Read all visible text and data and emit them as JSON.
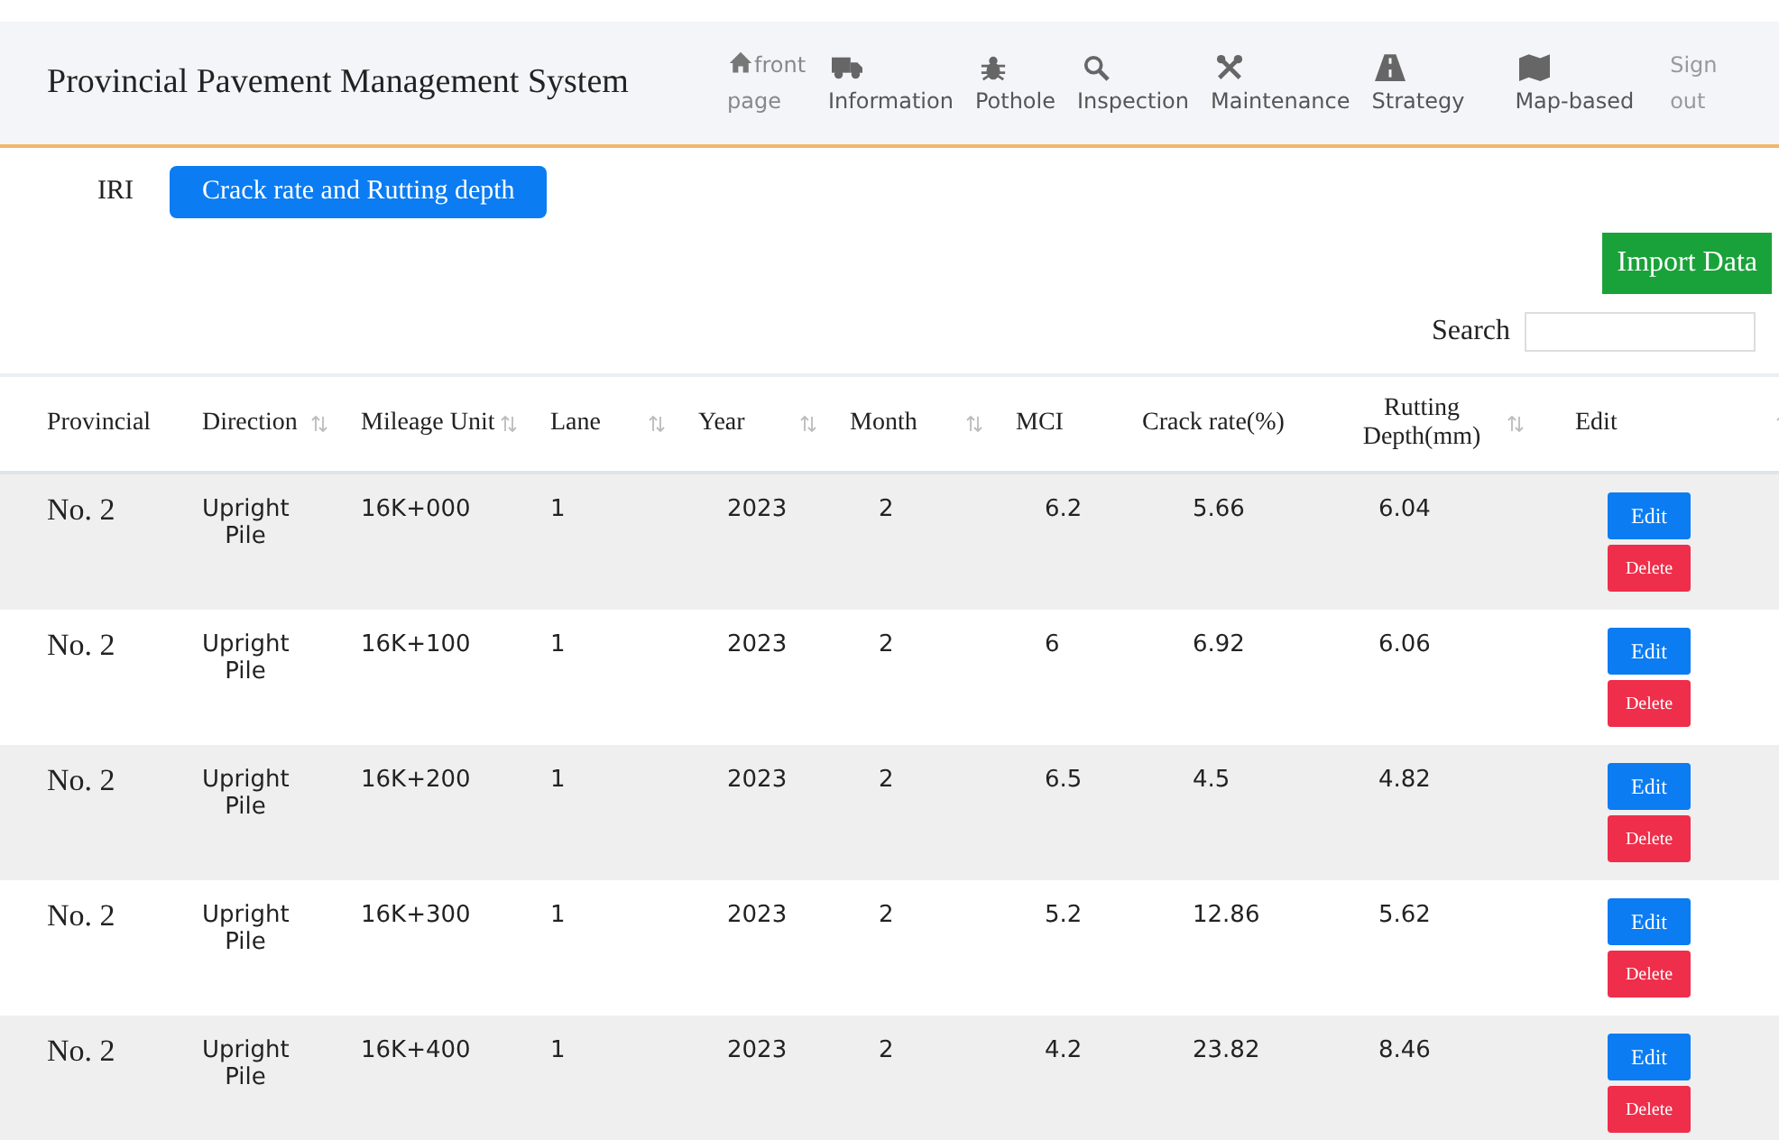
{
  "header": {
    "title": "Provincial Pavement Management System"
  },
  "nav": [
    {
      "label": "front page",
      "kind": "inline"
    },
    {
      "label": "Information",
      "kind": "stacked"
    },
    {
      "label": "Pothole",
      "kind": "stacked"
    },
    {
      "label": "Inspection",
      "kind": "stacked"
    },
    {
      "label": "Maintenance",
      "kind": "stacked"
    },
    {
      "label": "Strategy",
      "kind": "stacked"
    },
    {
      "label": "Map-based",
      "kind": "stacked"
    },
    {
      "label": "Sign out",
      "kind": "plain"
    }
  ],
  "tabs": [
    {
      "label": "IRI",
      "selected": false
    },
    {
      "label": "Crack rate and Rutting depth",
      "selected": true
    }
  ],
  "import_button": "Import Data",
  "search": {
    "label": "Search"
  },
  "table": {
    "columns": [
      {
        "label": "Provincial",
        "sortable": false
      },
      {
        "label": "Direction",
        "sortable": true
      },
      {
        "label": "Mileage Unit",
        "sortable": true
      },
      {
        "label": "Lane",
        "sortable": true
      },
      {
        "label": "Year",
        "sortable": true
      },
      {
        "label": "Month",
        "sortable": true
      },
      {
        "label": "MCI",
        "sortable": false
      },
      {
        "label": "Crack rate(%)",
        "sortable": false
      },
      {
        "label": "Rutting Depth(mm)",
        "sortable": true
      },
      {
        "label": "Edit",
        "sortable": true
      }
    ],
    "rows": [
      {
        "cells": [
          "No. 2",
          "Upright Pile",
          "16K+000",
          "1",
          "2023",
          "2",
          "6.2",
          "5.66",
          "6.04"
        ],
        "edit": "Edit",
        "delete": "Delete"
      },
      {
        "cells": [
          "No. 2",
          "Upright Pile",
          "16K+100",
          "1",
          "2023",
          "2",
          "6",
          "6.92",
          "6.06"
        ],
        "edit": "Edit",
        "delete": "Delete"
      },
      {
        "cells": [
          "No. 2",
          "Upright Pile",
          "16K+200",
          "1",
          "2023",
          "2",
          "6.5",
          "4.5",
          "4.82"
        ],
        "edit": "Edit",
        "delete": "Delete"
      },
      {
        "cells": [
          "No. 2",
          "Upright Pile",
          "16K+300",
          "1",
          "2023",
          "2",
          "5.2",
          "12.86",
          "5.62"
        ],
        "edit": "Edit",
        "delete": "Delete"
      },
      {
        "cells": [
          "No. 2",
          "Upright Pile",
          "16K+400",
          "1",
          "2023",
          "2",
          "4.2",
          "23.82",
          "8.46"
        ],
        "edit": "Edit",
        "delete": "Delete"
      }
    ]
  }
}
